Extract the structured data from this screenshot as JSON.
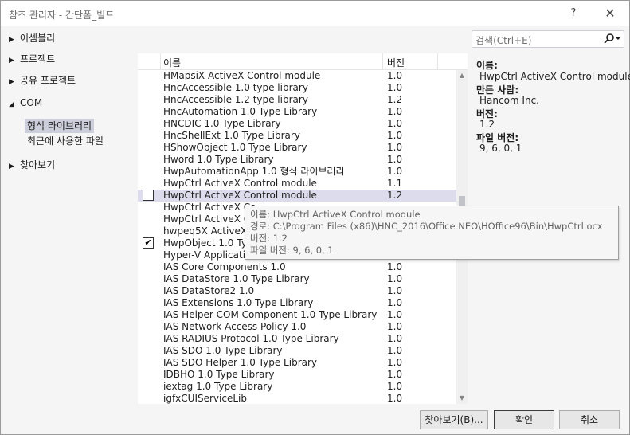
{
  "window": {
    "title": "참조 관리자 - 간단폼_빌드",
    "help_glyph": "?",
    "close_glyph": "✕"
  },
  "nav": {
    "assemblies": "어셈블리",
    "projects": "프로젝트",
    "shared_projects": "공유 프로젝트",
    "com": "COM",
    "com_children": [
      "형식 라이브러리",
      "최근에 사용한 파일"
    ],
    "browse": "찾아보기"
  },
  "list": {
    "col_name": "이름",
    "col_version": "버전",
    "rows": [
      {
        "name": "HMapsiX ActiveX Control module",
        "version": "1.0",
        "checked": null
      },
      {
        "name": "HncAccessible 1.0 type library",
        "version": "1.0",
        "checked": null
      },
      {
        "name": "HncAccessible 1.2 type library",
        "version": "1.2",
        "checked": null
      },
      {
        "name": "HncAutomation 1.0 Type Library",
        "version": "1.0",
        "checked": null
      },
      {
        "name": "HNCDIC 1.0 Type Library",
        "version": "1.0",
        "checked": null
      },
      {
        "name": "HncShellExt 1.0 Type Library",
        "version": "1.0",
        "checked": null
      },
      {
        "name": "HShowObject 1.0 Type Library",
        "version": "1.0",
        "checked": null
      },
      {
        "name": "Hword 1.0 Type Library",
        "version": "1.0",
        "checked": null
      },
      {
        "name": "HwpAutomationApp 1.0 형식 라이브러리",
        "version": "1.0",
        "checked": null
      },
      {
        "name": "HwpCtrl ActiveX Control module",
        "version": "1.1",
        "checked": null
      },
      {
        "name": "HwpCtrl ActiveX Control module",
        "version": "1.2",
        "checked": false
      },
      {
        "name": "HwpCtrl ActiveX Co",
        "version": "",
        "checked": null
      },
      {
        "name": "HwpCtrl ActiveX C",
        "version": "",
        "checked": null
      },
      {
        "name": "hwpeq5X ActiveX C",
        "version": "",
        "checked": null
      },
      {
        "name": "HwpObject 1.0 Typ",
        "version": "",
        "checked": true
      },
      {
        "name": "Hyper-V Applicatio",
        "version": "",
        "checked": null
      },
      {
        "name": "IAS Core Components 1.0",
        "version": "1.0",
        "checked": null
      },
      {
        "name": "IAS DataStore 1.0 Type Library",
        "version": "1.0",
        "checked": null
      },
      {
        "name": "IAS DataStore2 1.0",
        "version": "1.0",
        "checked": null
      },
      {
        "name": "IAS Extensions 1.0 Type Library",
        "version": "1.0",
        "checked": null
      },
      {
        "name": "IAS Helper COM Component 1.0 Type Library",
        "version": "1.0",
        "checked": null
      },
      {
        "name": "IAS Network Access Policy 1.0",
        "version": "1.0",
        "checked": null
      },
      {
        "name": "IAS RADIUS Protocol 1.0 Type Library",
        "version": "1.0",
        "checked": null
      },
      {
        "name": "IAS SDO 1.0 Type Library",
        "version": "1.0",
        "checked": null
      },
      {
        "name": "IAS SDO Helper 1.0 Type Library",
        "version": "1.0",
        "checked": null
      },
      {
        "name": "IDBHO 1.0 Type Library",
        "version": "1.0",
        "checked": null
      },
      {
        "name": "iextag 1.0 Type Library",
        "version": "1.0",
        "checked": null
      },
      {
        "name": "igfxCUIServiceLib",
        "version": "1.0",
        "checked": null
      }
    ]
  },
  "tooltip": {
    "lines": [
      "이름: HwpCtrl ActiveX Control module",
      "경로: C:\\Program Files (x86)\\HNC_2016\\Office NEO\\HOffice96\\Bin\\HwpCtrl.ocx",
      "버전: 1.2",
      "파일 버전: 9, 6, 0, 1"
    ]
  },
  "search": {
    "placeholder": "검색(Ctrl+E)",
    "icon": "search-icon"
  },
  "details": {
    "name_label": "이름:",
    "name_value": "HwpCtrl ActiveX Control module",
    "creator_label": "만든 사람:",
    "creator_value": "Hancom Inc.",
    "version_label": "버전:",
    "version_value": "1.2",
    "file_version_label": "파일 버전:",
    "file_version_value": "9, 6, 0, 1"
  },
  "buttons": {
    "browse": "찾아보기(B)...",
    "ok": "확인",
    "cancel": "취소"
  }
}
